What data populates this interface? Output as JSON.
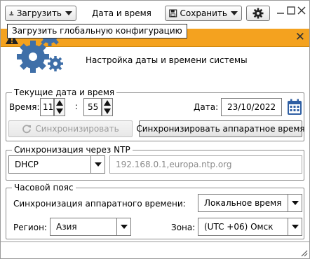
{
  "toolbar": {
    "load_label": "Загрузить",
    "title": "Дата и время",
    "save_label": "Сохранить"
  },
  "tooltip": {
    "text": "Загрузить глобальную конфигурацию"
  },
  "banner": {
    "text": "Настройка даты и времени системы"
  },
  "current": {
    "legend": "Текущие дата и время",
    "time_label": "Время:",
    "hour": "11",
    "separator": ":",
    "minute": "55",
    "date_label": "Дата:",
    "date": "23/10/2022",
    "sync_button": "Синхронизировать",
    "sync_hw_button": "Синхронизировать аппаратное время"
  },
  "ntp": {
    "legend": "Синхронизация через NTP",
    "mode": "DHCP",
    "servers": "192.168.0.1,europa.ntp.org"
  },
  "tz": {
    "legend": "Часовой пояс",
    "hw_sync_label": "Синхронизация аппаратного времени:",
    "hw_sync_value": "Локальное время",
    "region_label": "Регион:",
    "region_value": "Азия",
    "zone_label": "Зона:",
    "zone_value": "(UTC +06) Омск"
  },
  "colors": {
    "warning_bar": "#f4a21f",
    "gear_blue": "#3f6fa8"
  },
  "icons": [
    "download-icon",
    "save-icon",
    "gear-icon",
    "minimize-icon",
    "maximize-icon",
    "close-icon",
    "warning-icon",
    "calendar-icon",
    "refresh-icon",
    "resize-grip-icon"
  ]
}
